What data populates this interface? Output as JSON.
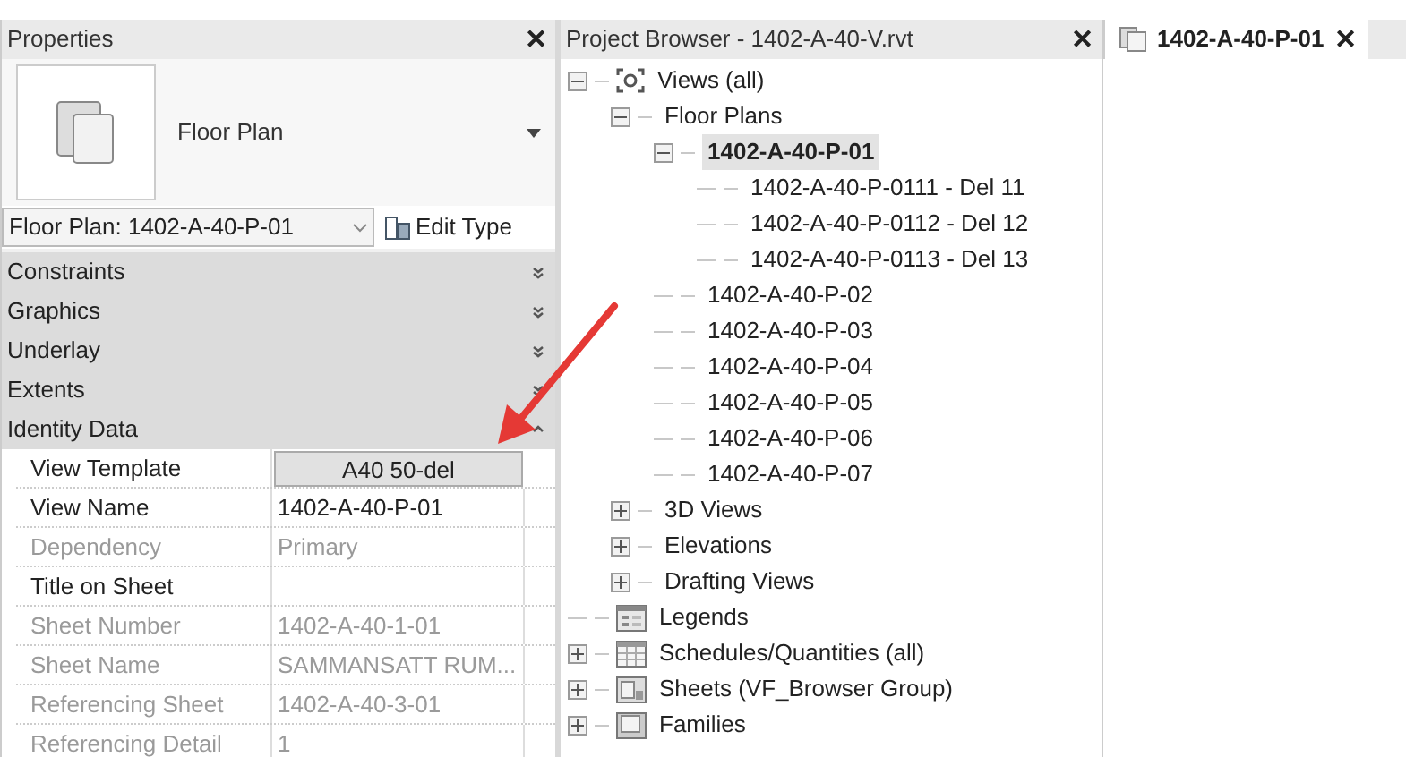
{
  "properties": {
    "title": "Properties",
    "close": "✕",
    "type_name": "Floor Plan",
    "instance": "Floor Plan: 1402-A-40-P-01",
    "edit_type": "Edit Type",
    "sections": [
      {
        "name": "Constraints",
        "expanded": false
      },
      {
        "name": "Graphics",
        "expanded": false
      },
      {
        "name": "Underlay",
        "expanded": false
      },
      {
        "name": "Extents",
        "expanded": false
      },
      {
        "name": "Identity Data",
        "expanded": true
      }
    ],
    "rows": [
      {
        "label": "View Template",
        "value": "A40 50-del",
        "kind": "button",
        "disabled": false
      },
      {
        "label": "View Name",
        "value": "1402-A-40-P-01",
        "kind": "text",
        "disabled": false
      },
      {
        "label": "Dependency",
        "value": "Primary",
        "kind": "text",
        "disabled": true
      },
      {
        "label": "Title on Sheet",
        "value": "",
        "kind": "text",
        "disabled": false
      },
      {
        "label": "Sheet Number",
        "value": "1402-A-40-1-01",
        "kind": "text",
        "disabled": true
      },
      {
        "label": "Sheet Name",
        "value": "SAMMANSATT RUM...",
        "kind": "text",
        "disabled": true
      },
      {
        "label": "Referencing Sheet",
        "value": "1402-A-40-3-01",
        "kind": "text",
        "disabled": true
      },
      {
        "label": "Referencing Detail",
        "value": "1",
        "kind": "text",
        "disabled": true
      }
    ]
  },
  "browser": {
    "title": "Project Browser - 1402-A-40-V.rvt",
    "close": "✕",
    "tree": [
      {
        "label": "Views (all)",
        "kind": "views",
        "expanded": true,
        "selected": false,
        "children": [
          {
            "label": "Floor Plans",
            "expanded": true,
            "selected": false,
            "children": [
              {
                "label": "1402-A-40-P-01",
                "expanded": true,
                "selected": true,
                "children": [
                  {
                    "label": "1402-A-40-P-0111 - Del 11",
                    "selected": false
                  },
                  {
                    "label": "1402-A-40-P-0112 - Del 12",
                    "selected": false
                  },
                  {
                    "label": "1402-A-40-P-0113 - Del 13",
                    "selected": false
                  }
                ]
              },
              {
                "label": "1402-A-40-P-02",
                "selected": false
              },
              {
                "label": "1402-A-40-P-03",
                "selected": false
              },
              {
                "label": "1402-A-40-P-04",
                "selected": false
              },
              {
                "label": "1402-A-40-P-05",
                "selected": false
              },
              {
                "label": "1402-A-40-P-06",
                "selected": false
              },
              {
                "label": "1402-A-40-P-07",
                "selected": false
              }
            ]
          },
          {
            "label": "3D Views",
            "expanded": false,
            "selected": false
          },
          {
            "label": "Elevations",
            "expanded": false,
            "selected": false
          },
          {
            "label": "Drafting Views",
            "expanded": false,
            "selected": false
          }
        ]
      },
      {
        "label": "Legends",
        "kind": "legends",
        "selected": false
      },
      {
        "label": "Schedules/Quantities (all)",
        "kind": "schedules",
        "expanded": false,
        "selected": false
      },
      {
        "label": "Sheets (VF_Browser Group)",
        "kind": "sheets",
        "expanded": false,
        "selected": false
      },
      {
        "label": "Families",
        "kind": "families",
        "expanded": false,
        "selected": false
      }
    ]
  },
  "view_tabs": [
    {
      "label": "1402-A-40-P-01",
      "close": "✕",
      "selected": true
    }
  ]
}
